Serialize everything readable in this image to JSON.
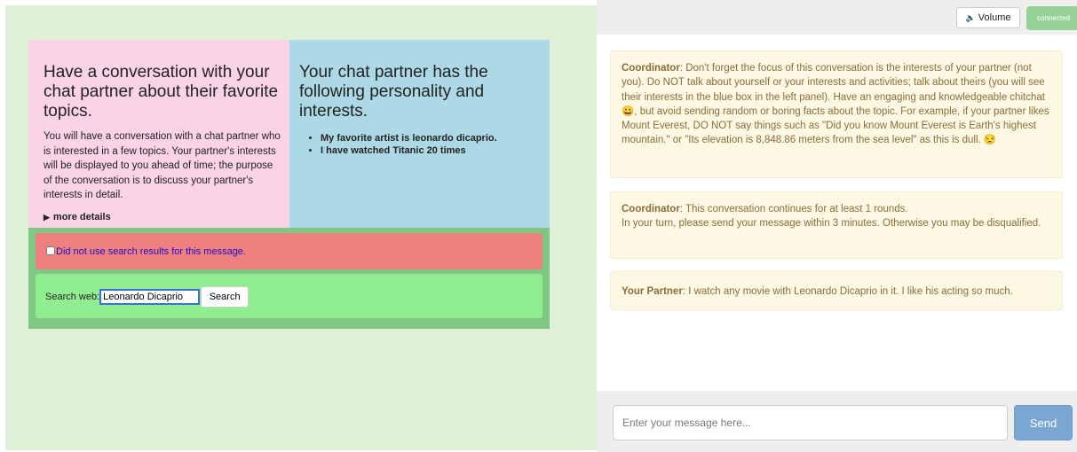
{
  "task": {
    "title": "Have a conversation with your chat partner about their favorite topics.",
    "body": "You will have a conversation with a chat partner who is interested in a few topics. Your partner's interests will be displayed to you ahead of time; the purpose of the conversation is to discuss your partner's interests in detail.",
    "more_details": "more details"
  },
  "persona": {
    "title": "Your chat partner has the following personality and interests.",
    "items": [
      "My favorite artist is leonardo dicaprio.",
      "I have watched Titanic 20 times"
    ]
  },
  "search": {
    "no_search_label": "Did not use search results for this message.",
    "no_search_checked": false,
    "label": "Search web:",
    "query": "Leonardo Dicaprio",
    "button_label": "Search"
  },
  "top_bar": {
    "volume_label": "Volume",
    "volume_icon": "speaker-icon",
    "connected_label": "connected"
  },
  "chat": {
    "messages": [
      {
        "sender": "Coordinator",
        "text": ": Don't forget the focus of this conversation is the interests of your partner (not you). Do NOT talk about yourself or your interests and activities; talk about theirs (you will see their interests in the blue box in the left panel). Have an engaging and knowledgeable chitchat 😀, but avoid sending random or boring facts about the topic. For example, if your partner likes Mount Everest, DO NOT say things such as \"Did you know Mount Everest is Earth's highest mountain.\" or \"Its elevation is 8,848.86 meters from the sea level\" as this is dull. 😒"
      },
      {
        "sender": "Coordinator",
        "text": ": This conversation continues for at least 1 rounds.",
        "text2": "In your turn, please send your message within 3 minutes. Otherwise you may be disqualified."
      },
      {
        "sender": "Your Partner",
        "text": ": I watch any movie with Leonardo Dicaprio in it. I like his acting so much."
      }
    ]
  },
  "compose": {
    "placeholder": "Enter your message here...",
    "send_label": "Send"
  },
  "colors": {
    "left_bg": "#dff0d8",
    "task_bg": "#fad3e6",
    "persona_bg": "#add8e6",
    "search_panel_bg": "#81c784",
    "no_search_bg": "#f08080",
    "search_row_bg": "#90ee90",
    "message_bg": "#fcf8e3",
    "message_text": "#8a6d3b",
    "send_bg": "#7aa7d1",
    "connected_bg": "#96d296"
  }
}
